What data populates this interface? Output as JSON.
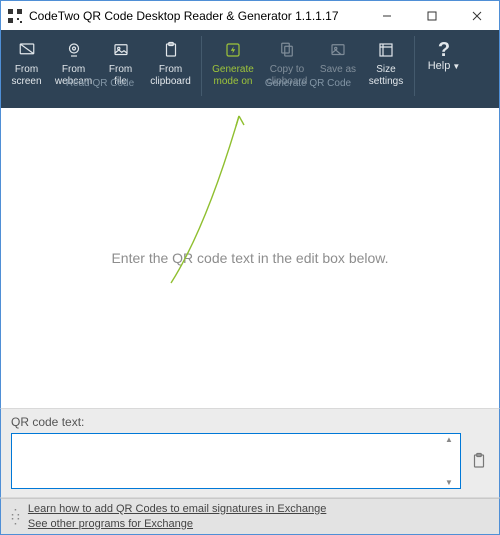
{
  "window": {
    "title": "CodeTwo QR Code Desktop Reader & Generator 1.1.1.17"
  },
  "toolbar": {
    "read_group_label": "Read QR Code",
    "gen_group_label": "Generate QR Code",
    "from_screen": "From\nscreen",
    "from_webcam": "From\nwebcam",
    "from_file": "From\nfile",
    "from_clipboard": "From\nclipboard",
    "generate_mode": "Generate\nmode on",
    "copy_to_clipboard": "Copy to\nclipboard",
    "save_as": "Save as",
    "size_settings": "Size\nsettings",
    "help_label": "Help"
  },
  "canvas": {
    "placeholder": "Enter the QR code text in the edit box below."
  },
  "panel": {
    "label": "QR code text:",
    "value": ""
  },
  "footer": {
    "link1": "Learn how to add QR Codes to email signatures in Exchange",
    "link2": "See other programs for Exchange"
  }
}
